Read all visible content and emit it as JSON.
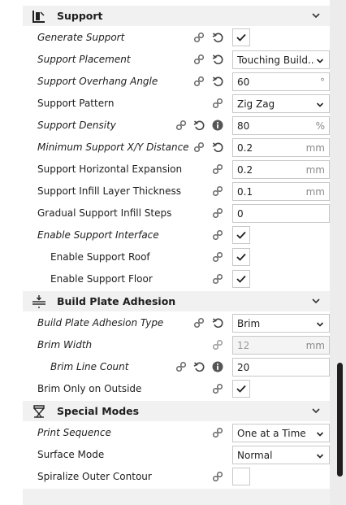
{
  "sections": {
    "support": {
      "title": "Support",
      "icon": "support-icon"
    },
    "adhesion": {
      "title": "Build Plate Adhesion",
      "icon": "adhesion-icon"
    },
    "special": {
      "title": "Special Modes",
      "icon": "special-modes-icon"
    }
  },
  "support": {
    "generate_support": {
      "label": "Generate Support",
      "checked": true
    },
    "placement": {
      "label": "Support Placement",
      "value": "Touching Build..."
    },
    "overhang_angle": {
      "label": "Support Overhang Angle",
      "value": "60",
      "unit": "°"
    },
    "pattern": {
      "label": "Support Pattern",
      "value": "Zig Zag"
    },
    "density": {
      "label": "Support Density",
      "value": "80",
      "unit": "%"
    },
    "min_xy_distance": {
      "label": "Minimum Support X/Y Distance",
      "value": "0.2",
      "unit": "mm"
    },
    "horizontal_expansion": {
      "label": "Support Horizontal Expansion",
      "value": "0.2",
      "unit": "mm"
    },
    "infill_layer_thickness": {
      "label": "Support Infill Layer Thickness",
      "value": "0.1",
      "unit": "mm"
    },
    "gradual_infill_steps": {
      "label": "Gradual Support Infill Steps",
      "value": "0"
    },
    "enable_interface": {
      "label": "Enable Support Interface",
      "checked": true
    },
    "enable_roof": {
      "label": "Enable Support Roof",
      "checked": true
    },
    "enable_floor": {
      "label": "Enable Support Floor",
      "checked": true
    }
  },
  "adhesion": {
    "type": {
      "label": "Build Plate Adhesion Type",
      "value": "Brim"
    },
    "brim_width": {
      "label": "Brim Width",
      "value": "12",
      "unit": "mm"
    },
    "brim_line_count": {
      "label": "Brim Line Count",
      "value": "20"
    },
    "brim_only_outside": {
      "label": "Brim Only on Outside",
      "checked": true
    }
  },
  "special": {
    "print_sequence": {
      "label": "Print Sequence",
      "value": "One at a Time"
    },
    "surface_mode": {
      "label": "Surface Mode",
      "value": "Normal"
    },
    "spiralize": {
      "label": "Spiralize Outer Contour",
      "checked": false
    }
  }
}
